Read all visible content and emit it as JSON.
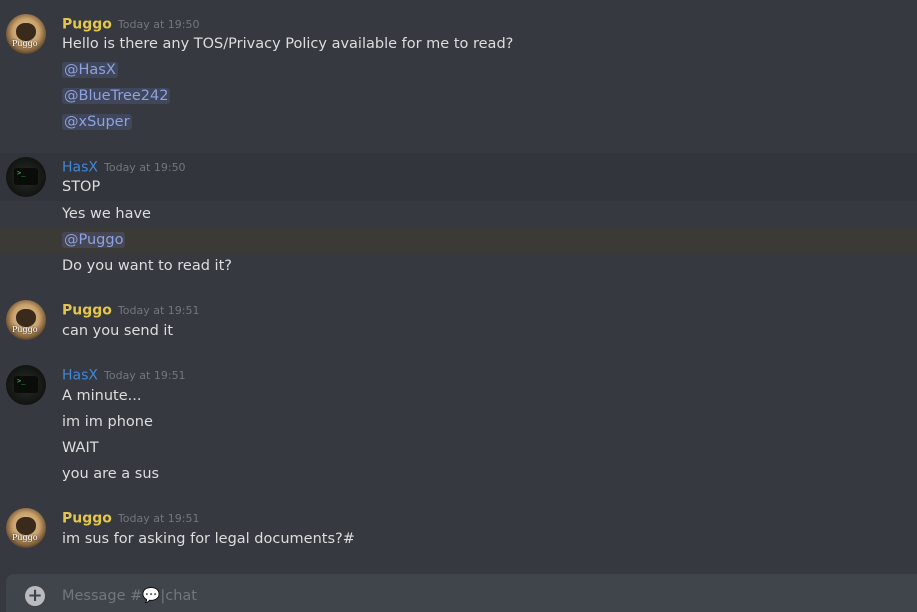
{
  "messages": [
    {
      "author": "Puggo",
      "timestamp": "Today at 19:50",
      "lines": [
        "Hello is there any TOS/Privacy Policy available for me to read?",
        "@HasX",
        "@BlueTree242",
        "@xSuper"
      ]
    },
    {
      "author": "HasX",
      "timestamp": "Today at 19:50",
      "lines": [
        "STOP",
        "Yes we have",
        "@Puggo",
        "Do you want to read it?"
      ]
    },
    {
      "author": "Puggo",
      "timestamp": "Today at 19:51",
      "lines": [
        "can you send it"
      ]
    },
    {
      "author": "HasX",
      "timestamp": "Today at 19:51",
      "lines": [
        "A minute...",
        "im im phone",
        "WAIT",
        "you are a sus"
      ]
    },
    {
      "author": "Puggo",
      "timestamp": "Today at 19:51",
      "lines": [
        "im sus for asking for legal documents?#"
      ]
    }
  ],
  "avatars": {
    "puggo_text": "Puggo",
    "hasx_prompt": ">_"
  },
  "composer": {
    "add_icon": "+",
    "placeholder": "Message #💬|chat"
  },
  "colors": {
    "background": "#36393f",
    "puggo_name": "#e3c64a",
    "hasx_name": "#3f86d9",
    "mention": "#8ea1e1"
  }
}
